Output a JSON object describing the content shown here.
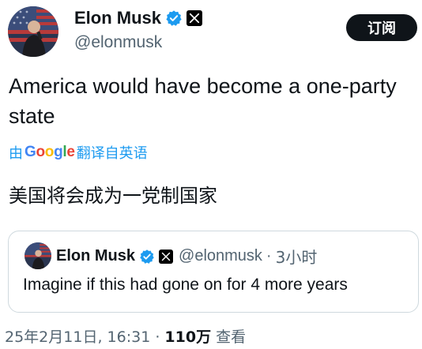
{
  "author": {
    "display_name": "Elon Musk",
    "handle": "@elonmusk"
  },
  "subscribe_label": "订阅",
  "tweet": {
    "text": "America would have become a one-party state",
    "translate_prefix": "由",
    "translate_brand": "Google",
    "translate_suffix": "翻译自英语",
    "translated_text": "美国将会成为一党制国家"
  },
  "quote": {
    "display_name": "Elon Musk",
    "handle": "@elonmusk",
    "separator": "·",
    "time": "3小时",
    "text": "Imagine if this had gone on for 4 more years"
  },
  "meta": {
    "date": "25年2月11日, 16:31",
    "separator": "·",
    "views_count": "110万",
    "views_label": "查看"
  },
  "colors": {
    "link_blue": "#1d9bf0",
    "verified_blue": "#1d9bf0",
    "text_primary": "#0f1419",
    "text_secondary": "#536471",
    "button_bg": "#0f1419"
  },
  "icons": {
    "verified": "verified-badge-icon",
    "x_logo": "x-logo-icon"
  }
}
